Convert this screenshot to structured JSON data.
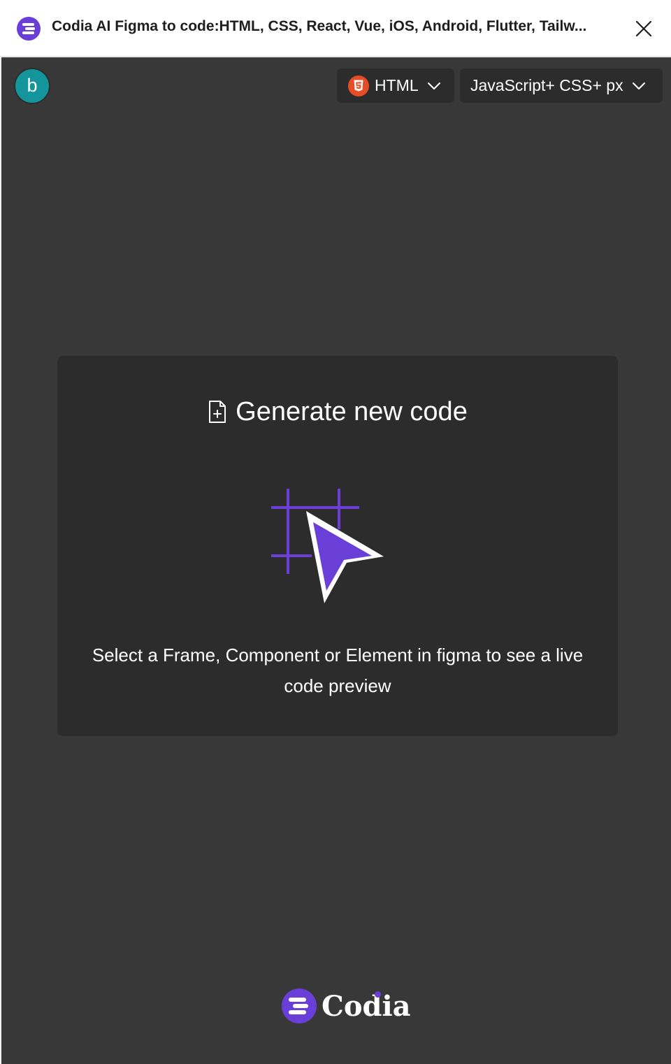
{
  "window": {
    "title": "Codia AI Figma to code:HTML, CSS, React, Vue, iOS, Android, Flutter, Tailw..."
  },
  "user": {
    "avatar_initial": "b"
  },
  "toolbar": {
    "framework": {
      "label": "HTML",
      "icon": "html5-icon"
    },
    "language": {
      "label": "JavaScript+ CSS+ px"
    }
  },
  "empty_state": {
    "title": "Generate new code",
    "description": "Select a Frame, Component or Element in figma to see a live code preview"
  },
  "footer": {
    "brand": "Codia"
  },
  "colors": {
    "accent": "#6a3fd8",
    "panel_bg": "#383838",
    "card_bg": "#2c2c2c",
    "avatar_bg": "#13959b",
    "html5_orange": "#e44d26"
  }
}
